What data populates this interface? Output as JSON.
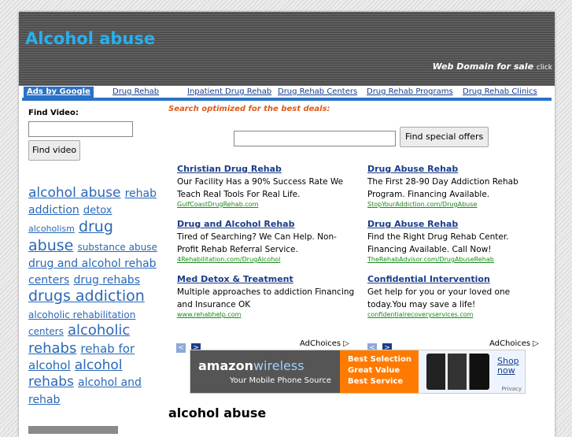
{
  "header": {
    "title": "Alcohol abuse",
    "domain_sale": "Web Domain for sale",
    "click": "click"
  },
  "adbar": {
    "ads_by": "Ads by Google",
    "links": [
      "Drug Rehab",
      "Inpatient Drug Rehab",
      "Drug Rehab Centers",
      "Drug Rehab Programs",
      "Drug Rehab Clinics"
    ]
  },
  "sidebar": {
    "find_video_label": "Find Video:",
    "find_video_button": "Find video"
  },
  "tags": [
    {
      "text": "alcohol abuse",
      "size": "17px"
    },
    {
      "text": "rehab addiction",
      "size": "14px"
    },
    {
      "text": "detox",
      "size": "13px"
    },
    {
      "text": "alcoholism",
      "size": "11px"
    },
    {
      "text": "drug abuse",
      "size": "19px"
    },
    {
      "text": "substance abuse",
      "size": "12px"
    },
    {
      "text": "drug and alcohol rehab centers",
      "size": "14px"
    },
    {
      "text": "drug rehabs",
      "size": "14px"
    },
    {
      "text": "drugs addiction",
      "size": "19px"
    },
    {
      "text": "alcoholic rehabilitation centers",
      "size": "12px"
    },
    {
      "text": "alcoholic rehabs",
      "size": "18px"
    },
    {
      "text": "rehab for alcohol",
      "size": "15px"
    },
    {
      "text": "alcohol rehabs",
      "size": "17px"
    },
    {
      "text": "alcohol and rehab",
      "size": "14px"
    }
  ],
  "main": {
    "search_hint": "Search optimized for the best deals:",
    "search_button": "Find special offers",
    "ads": [
      {
        "title": "Christian Drug Rehab",
        "desc": "Our Facility Has a 90% Success Rate We Teach Real Tools For Real Life.",
        "url": "GulfCoastDrugRehab.com"
      },
      {
        "title": "Drug Abuse Rehab",
        "desc": "The First 28-90 Day Addiction Rehab Program. Financing Available.",
        "url": "StopYourAddiction.com/DrugAbuse"
      },
      {
        "title": "Drug and Alcohol Rehab",
        "desc": "Tired of Searching? We Can Help. Non-Profit Rehab Referral Service.",
        "url": "4Rehabilitation.com/DrugAlcohol"
      },
      {
        "title": "Drug Abuse Rehab",
        "desc": "Find the Right Drug Rehab Center. Financing Available. Call Now!",
        "url": "TheRehabAdvisor.com/DrugAbuseRehab"
      },
      {
        "title": "Med Detox & Treatment",
        "desc": "Multiple approaches to addiction Financing and Insurance OK",
        "url": "www.rehabhelp.com"
      },
      {
        "title": "Confidential Intervention",
        "desc": "Get help for you or your loved one today.You may save a life!",
        "url": "confidentialrecoveryservices.com"
      }
    ],
    "adchoices": "AdChoices ▷",
    "prev_glyph": "<",
    "next_glyph": ">",
    "banner": {
      "brand": "amazon",
      "brand_suffix": "wireless",
      "tagline": "Your Mobile Phone Source",
      "points": [
        "Best Selection",
        "Great Value",
        "Best Service"
      ],
      "shop": "Shop now",
      "privacy": "Privacy"
    },
    "heading": "alcohol abuse"
  }
}
